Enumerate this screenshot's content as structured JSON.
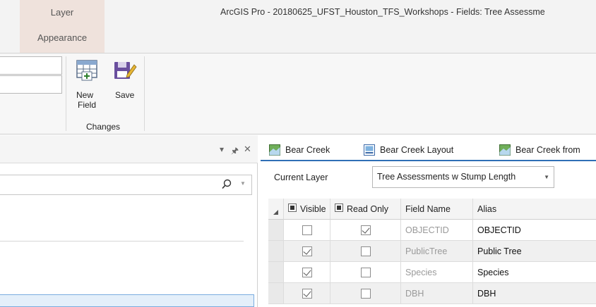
{
  "titlebar": {
    "contextual_tab": "Layer",
    "contextual_subtab": "Appearance",
    "window_title": "ArcGIS Pro - 20180625_UFST_Houston_TFS_Workshops - Fields:  Tree Assessme"
  },
  "ribbon": {
    "new_field_line1": "New",
    "new_field_line2": "Field",
    "save_label": "Save",
    "group_label": "Changes"
  },
  "left_pane": {
    "pin_glyph": "↓ ❉ ✕",
    "search_placeholder": ""
  },
  "view_tabs": [
    {
      "label": "Bear Creek",
      "icon": "map-view-icon"
    },
    {
      "label": "Bear Creek Layout",
      "icon": "layout-view-icon"
    },
    {
      "label": "Bear Creek from",
      "icon": "map-view-icon"
    }
  ],
  "fields_view": {
    "current_layer_label": "Current Layer",
    "current_layer_value": "Tree Assessments w Stump Length",
    "columns": [
      "Visible",
      "Read Only",
      "Field Name",
      "Alias"
    ],
    "rows": [
      {
        "visible": false,
        "read_only": true,
        "field_name": "OBJECTID",
        "alias": "OBJECTID"
      },
      {
        "visible": true,
        "read_only": false,
        "field_name": "PublicTree",
        "alias": "Public Tree"
      },
      {
        "visible": true,
        "read_only": false,
        "field_name": "Species",
        "alias": "Species"
      },
      {
        "visible": true,
        "read_only": false,
        "field_name": "DBH",
        "alias": "DBH"
      }
    ]
  },
  "colors": {
    "contextual_tab_bg": "#efe2dc",
    "accent_underline": "#2f6fb6",
    "selection_border": "#7aacdf"
  }
}
